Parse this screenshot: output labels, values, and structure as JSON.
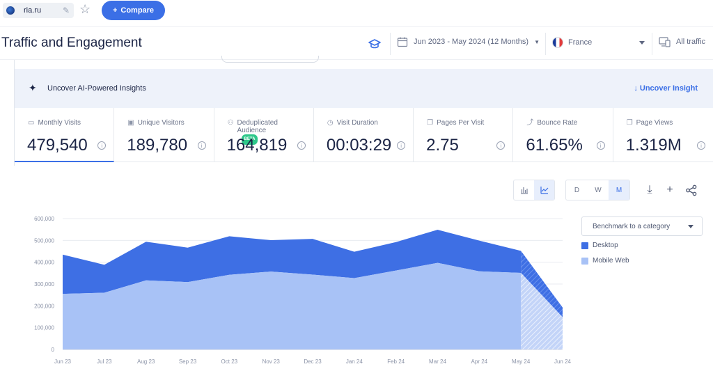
{
  "topbar": {
    "site": "ria.ru",
    "compare_label": "Compare",
    "compare_icon": "+"
  },
  "header": {
    "title": "Traffic and Engagement",
    "date_range": "Jun 2023 - May 2024 (12 Months)",
    "country": "France",
    "traffic": "All traffic"
  },
  "insights": {
    "label": "Uncover AI-Powered Insights",
    "link": "Uncover Insight"
  },
  "metrics": [
    {
      "label": "Monthly Visits",
      "value": "479,540"
    },
    {
      "label": "Unique Visitors",
      "value": "189,780"
    },
    {
      "label": "Deduplicated Audience",
      "value": "164,819",
      "badge": "BETA"
    },
    {
      "label": "Visit Duration",
      "value": "00:03:29"
    },
    {
      "label": "Pages Per Visit",
      "value": "2.75"
    },
    {
      "label": "Bounce Rate",
      "value": "61.65%"
    },
    {
      "label": "Page Views",
      "value": "1.319M"
    }
  ],
  "controls": {
    "granularity": [
      "D",
      "W",
      "M"
    ],
    "selected": "M"
  },
  "benchmark": {
    "label": "Benchmark to a category"
  },
  "colors": {
    "accent": "#3b6fe6",
    "desktop": "#3e6fe4",
    "mobile": "#a8c2f6"
  },
  "chart_data": {
    "type": "area",
    "stacked": true,
    "categories": [
      "Jun 23",
      "Jul 23",
      "Aug 23",
      "Sep 23",
      "Oct 23",
      "Nov 23",
      "Dec 23",
      "Jan 24",
      "Feb 24",
      "Mar 24",
      "Apr 24",
      "May 24",
      "Jun 24"
    ],
    "series": [
      {
        "name": "Mobile Web",
        "values": [
          255000,
          260000,
          317000,
          309000,
          342000,
          357000,
          343000,
          327000,
          362000,
          397000,
          358000,
          351000,
          148000
        ]
      },
      {
        "name": "Desktop",
        "values": [
          180000,
          128000,
          177000,
          158000,
          177000,
          144000,
          164000,
          121000,
          130000,
          152000,
          141000,
          101000,
          44000
        ]
      }
    ],
    "ylim": [
      0,
      600000
    ],
    "yticks": [
      "0",
      "100,000",
      "200,000",
      "300,000",
      "400,000",
      "500,000",
      "600,000"
    ],
    "grid": true,
    "legend_position": "right",
    "partial_last_period": true
  }
}
